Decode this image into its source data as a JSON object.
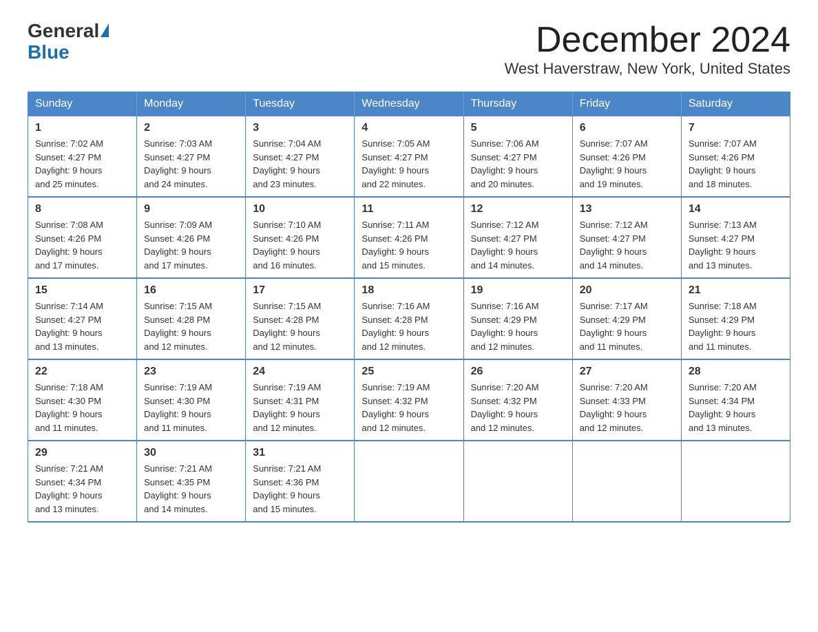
{
  "header": {
    "logo_general": "General",
    "logo_blue": "Blue",
    "month_title": "December 2024",
    "location": "West Haverstraw, New York, United States"
  },
  "weekdays": [
    "Sunday",
    "Monday",
    "Tuesday",
    "Wednesday",
    "Thursday",
    "Friday",
    "Saturday"
  ],
  "weeks": [
    [
      {
        "day": "1",
        "sunrise": "7:02 AM",
        "sunset": "4:27 PM",
        "daylight": "9 hours and 25 minutes."
      },
      {
        "day": "2",
        "sunrise": "7:03 AM",
        "sunset": "4:27 PM",
        "daylight": "9 hours and 24 minutes."
      },
      {
        "day": "3",
        "sunrise": "7:04 AM",
        "sunset": "4:27 PM",
        "daylight": "9 hours and 23 minutes."
      },
      {
        "day": "4",
        "sunrise": "7:05 AM",
        "sunset": "4:27 PM",
        "daylight": "9 hours and 22 minutes."
      },
      {
        "day": "5",
        "sunrise": "7:06 AM",
        "sunset": "4:27 PM",
        "daylight": "9 hours and 20 minutes."
      },
      {
        "day": "6",
        "sunrise": "7:07 AM",
        "sunset": "4:26 PM",
        "daylight": "9 hours and 19 minutes."
      },
      {
        "day": "7",
        "sunrise": "7:07 AM",
        "sunset": "4:26 PM",
        "daylight": "9 hours and 18 minutes."
      }
    ],
    [
      {
        "day": "8",
        "sunrise": "7:08 AM",
        "sunset": "4:26 PM",
        "daylight": "9 hours and 17 minutes."
      },
      {
        "day": "9",
        "sunrise": "7:09 AM",
        "sunset": "4:26 PM",
        "daylight": "9 hours and 17 minutes."
      },
      {
        "day": "10",
        "sunrise": "7:10 AM",
        "sunset": "4:26 PM",
        "daylight": "9 hours and 16 minutes."
      },
      {
        "day": "11",
        "sunrise": "7:11 AM",
        "sunset": "4:26 PM",
        "daylight": "9 hours and 15 minutes."
      },
      {
        "day": "12",
        "sunrise": "7:12 AM",
        "sunset": "4:27 PM",
        "daylight": "9 hours and 14 minutes."
      },
      {
        "day": "13",
        "sunrise": "7:12 AM",
        "sunset": "4:27 PM",
        "daylight": "9 hours and 14 minutes."
      },
      {
        "day": "14",
        "sunrise": "7:13 AM",
        "sunset": "4:27 PM",
        "daylight": "9 hours and 13 minutes."
      }
    ],
    [
      {
        "day": "15",
        "sunrise": "7:14 AM",
        "sunset": "4:27 PM",
        "daylight": "9 hours and 13 minutes."
      },
      {
        "day": "16",
        "sunrise": "7:15 AM",
        "sunset": "4:28 PM",
        "daylight": "9 hours and 12 minutes."
      },
      {
        "day": "17",
        "sunrise": "7:15 AM",
        "sunset": "4:28 PM",
        "daylight": "9 hours and 12 minutes."
      },
      {
        "day": "18",
        "sunrise": "7:16 AM",
        "sunset": "4:28 PM",
        "daylight": "9 hours and 12 minutes."
      },
      {
        "day": "19",
        "sunrise": "7:16 AM",
        "sunset": "4:29 PM",
        "daylight": "9 hours and 12 minutes."
      },
      {
        "day": "20",
        "sunrise": "7:17 AM",
        "sunset": "4:29 PM",
        "daylight": "9 hours and 11 minutes."
      },
      {
        "day": "21",
        "sunrise": "7:18 AM",
        "sunset": "4:29 PM",
        "daylight": "9 hours and 11 minutes."
      }
    ],
    [
      {
        "day": "22",
        "sunrise": "7:18 AM",
        "sunset": "4:30 PM",
        "daylight": "9 hours and 11 minutes."
      },
      {
        "day": "23",
        "sunrise": "7:19 AM",
        "sunset": "4:30 PM",
        "daylight": "9 hours and 11 minutes."
      },
      {
        "day": "24",
        "sunrise": "7:19 AM",
        "sunset": "4:31 PM",
        "daylight": "9 hours and 12 minutes."
      },
      {
        "day": "25",
        "sunrise": "7:19 AM",
        "sunset": "4:32 PM",
        "daylight": "9 hours and 12 minutes."
      },
      {
        "day": "26",
        "sunrise": "7:20 AM",
        "sunset": "4:32 PM",
        "daylight": "9 hours and 12 minutes."
      },
      {
        "day": "27",
        "sunrise": "7:20 AM",
        "sunset": "4:33 PM",
        "daylight": "9 hours and 12 minutes."
      },
      {
        "day": "28",
        "sunrise": "7:20 AM",
        "sunset": "4:34 PM",
        "daylight": "9 hours and 13 minutes."
      }
    ],
    [
      {
        "day": "29",
        "sunrise": "7:21 AM",
        "sunset": "4:34 PM",
        "daylight": "9 hours and 13 minutes."
      },
      {
        "day": "30",
        "sunrise": "7:21 AM",
        "sunset": "4:35 PM",
        "daylight": "9 hours and 14 minutes."
      },
      {
        "day": "31",
        "sunrise": "7:21 AM",
        "sunset": "4:36 PM",
        "daylight": "9 hours and 15 minutes."
      },
      null,
      null,
      null,
      null
    ]
  ],
  "labels": {
    "sunrise": "Sunrise:",
    "sunset": "Sunset:",
    "daylight": "Daylight:"
  }
}
